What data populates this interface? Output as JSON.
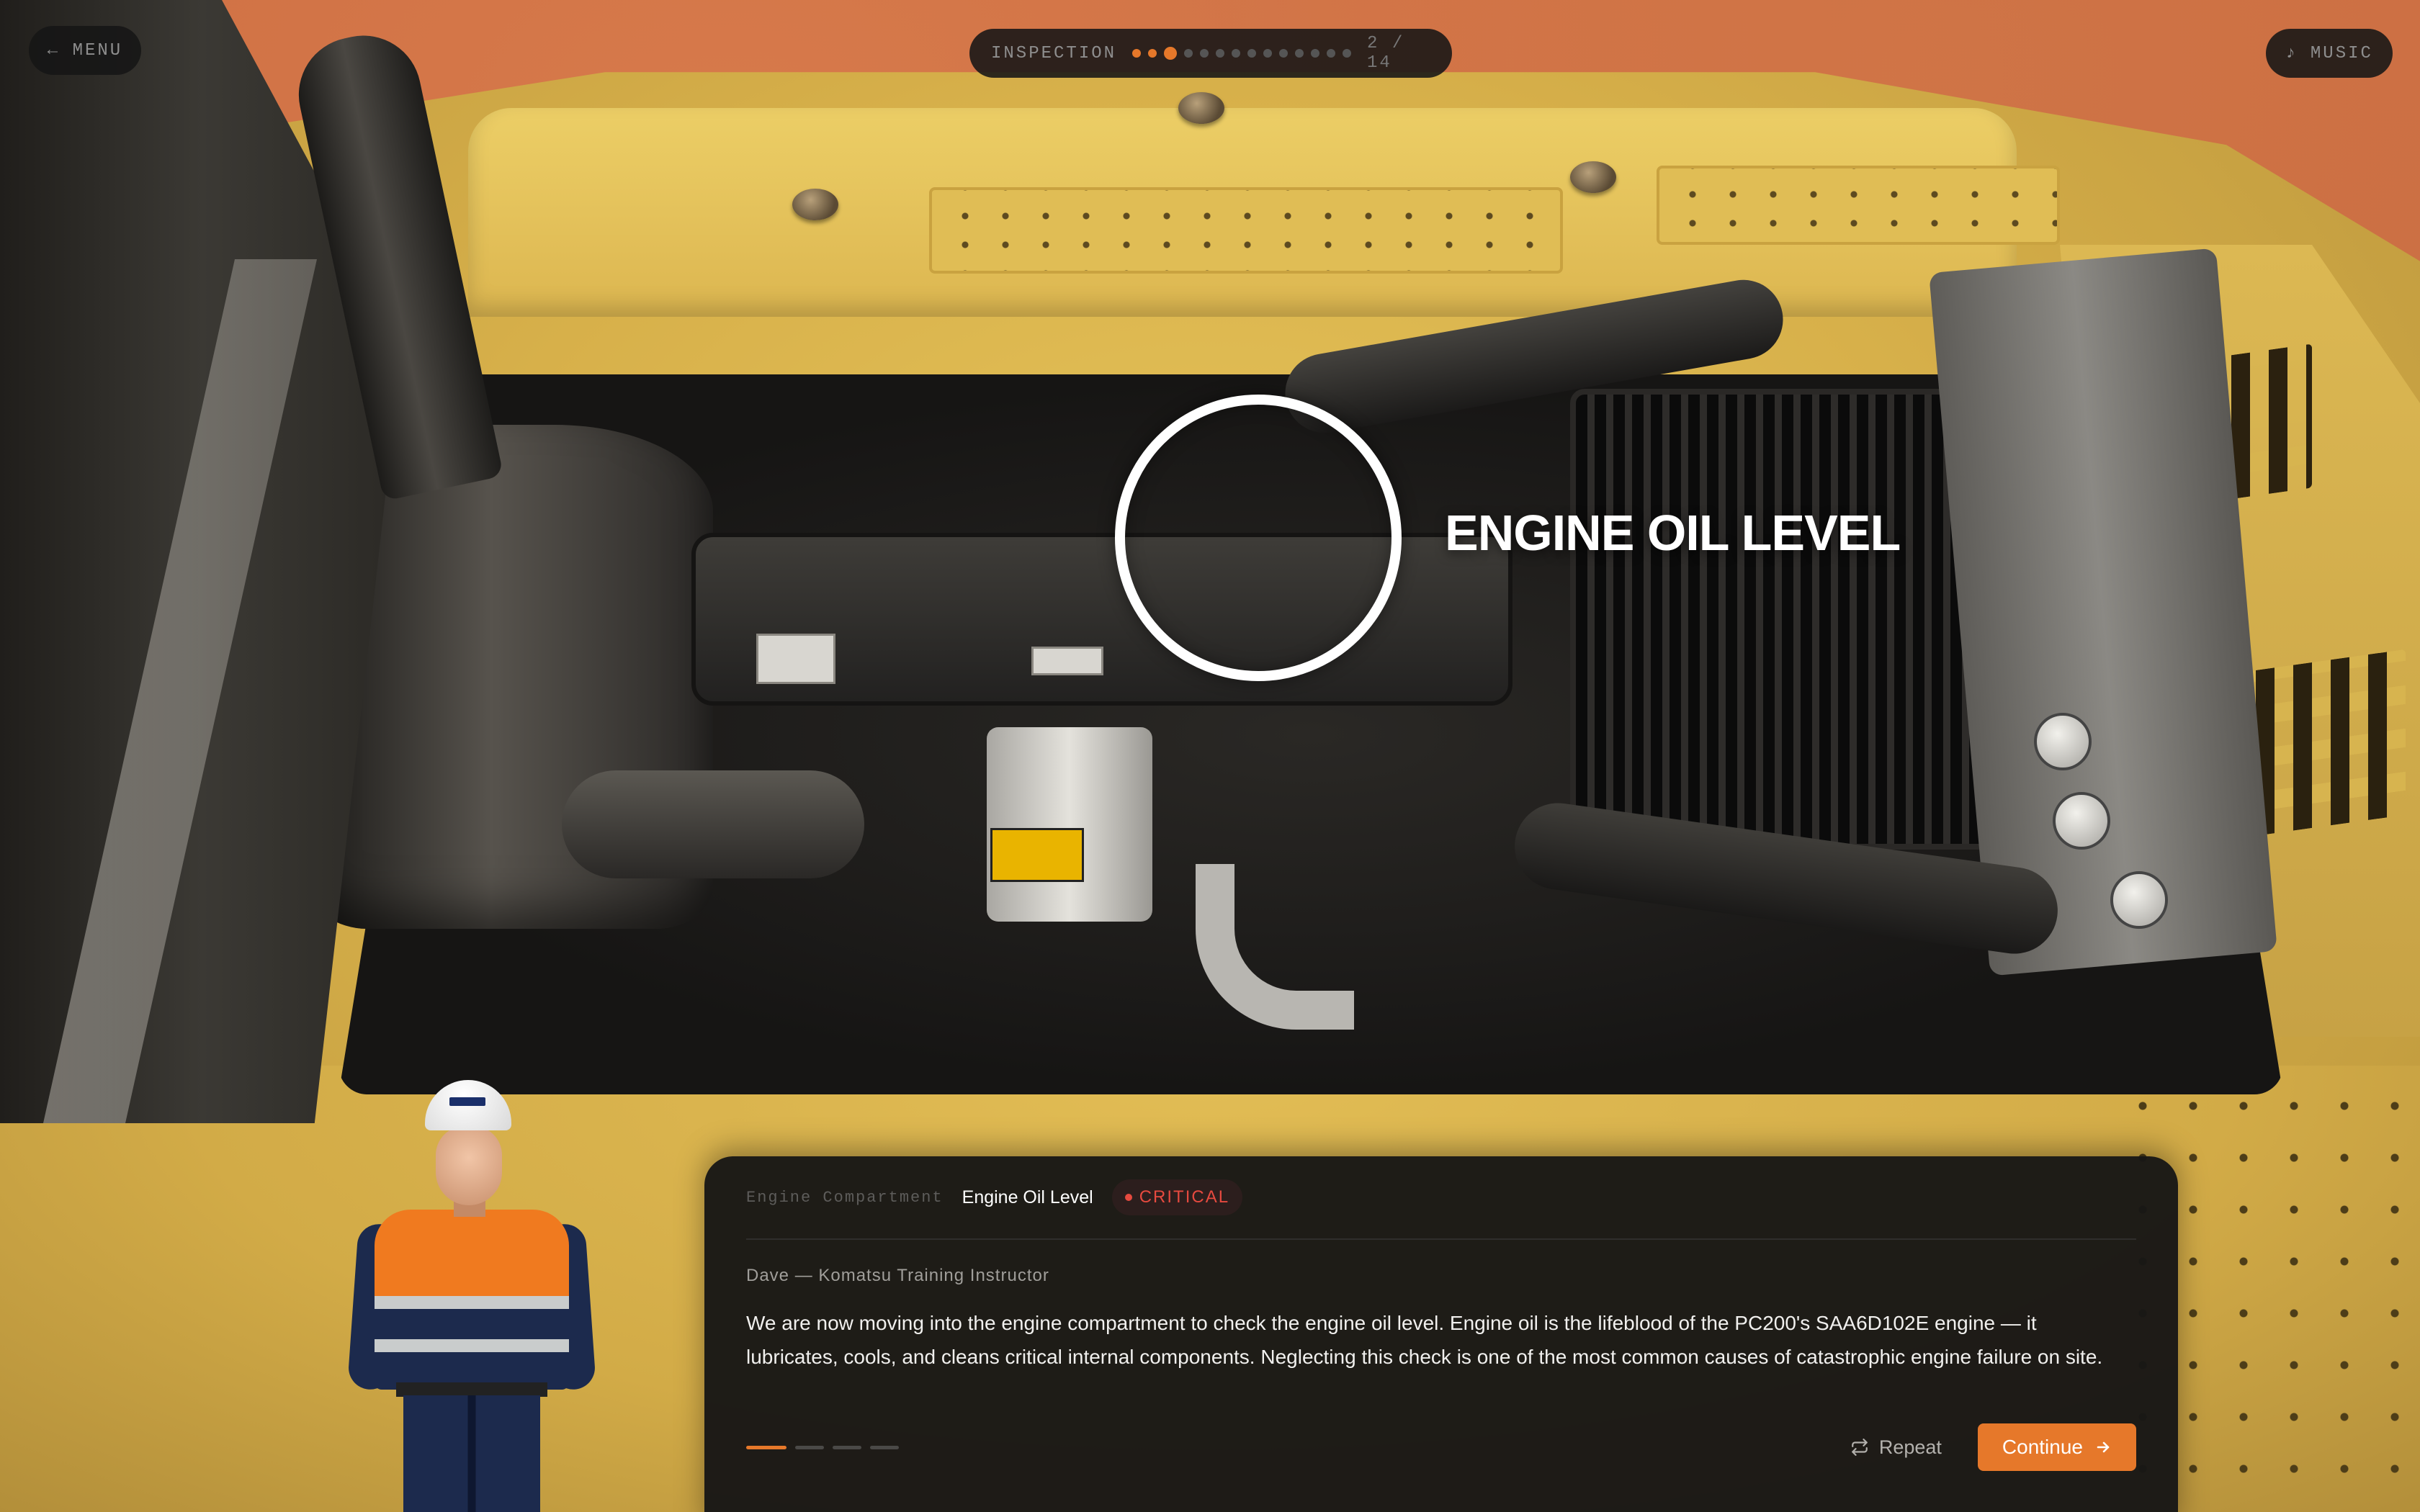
{
  "topbar": {
    "menu_label": "← MENU",
    "music_label": "♪ MUSIC",
    "progress": {
      "label": "INSPECTION",
      "current_step": 2,
      "total_steps": 14,
      "counter": "2 / 14"
    }
  },
  "hotspot": {
    "label": "ENGINE OIL LEVEL"
  },
  "panel": {
    "breadcrumb_parent": "Engine Compartment",
    "breadcrumb_current": "Engine Oil Level",
    "badge": "CRITICAL",
    "speaker": "Dave — Komatsu Training Instructor",
    "dialog": "We are now moving into the engine compartment to check the engine oil level. Engine oil is the lifeblood of the PC200's SAA6D102E engine — it lubricates, cools, and cleans critical internal components. Neglecting this check is one of the most common causes of catastrophic engine failure on site.",
    "dialog_step": 1,
    "dialog_total_steps": 4,
    "repeat_label": "Repeat",
    "continue_label": "Continue"
  },
  "colors": {
    "accent": "#e6782a",
    "critical": "#e64a3f",
    "panel_bg": "#181716"
  },
  "icons": {
    "repeat": "repeat-icon",
    "continue": "arrow-right-icon"
  }
}
